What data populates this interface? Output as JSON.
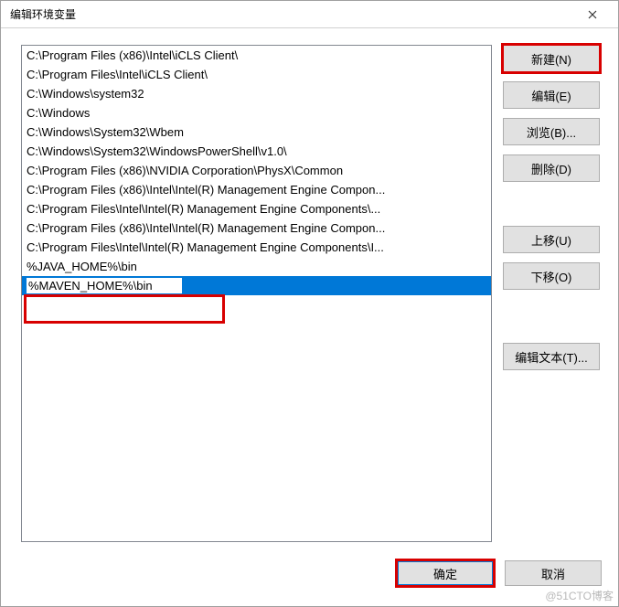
{
  "window": {
    "title": "编辑环境变量"
  },
  "list": {
    "items": [
      "C:\\Program Files (x86)\\Intel\\iCLS Client\\",
      "C:\\Program Files\\Intel\\iCLS Client\\",
      "C:\\Windows\\system32",
      "C:\\Windows",
      "C:\\Windows\\System32\\Wbem",
      "C:\\Windows\\System32\\WindowsPowerShell\\v1.0\\",
      "C:\\Program Files (x86)\\NVIDIA Corporation\\PhysX\\Common",
      "C:\\Program Files (x86)\\Intel\\Intel(R) Management Engine Compon...",
      "C:\\Program Files\\Intel\\Intel(R) Management Engine Components\\...",
      "C:\\Program Files (x86)\\Intel\\Intel(R) Management Engine Compon...",
      "C:\\Program Files\\Intel\\Intel(R) Management Engine Components\\I...",
      "%JAVA_HOME%\\bin"
    ],
    "editing_value": "%MAVEN_HOME%\\bin"
  },
  "buttons": {
    "new": "新建(N)",
    "edit": "编辑(E)",
    "browse": "浏览(B)...",
    "delete": "删除(D)",
    "moveup": "上移(U)",
    "movedown": "下移(O)",
    "edittext": "编辑文本(T)...",
    "ok": "确定",
    "cancel": "取消"
  },
  "watermark": "@51CTO博客"
}
